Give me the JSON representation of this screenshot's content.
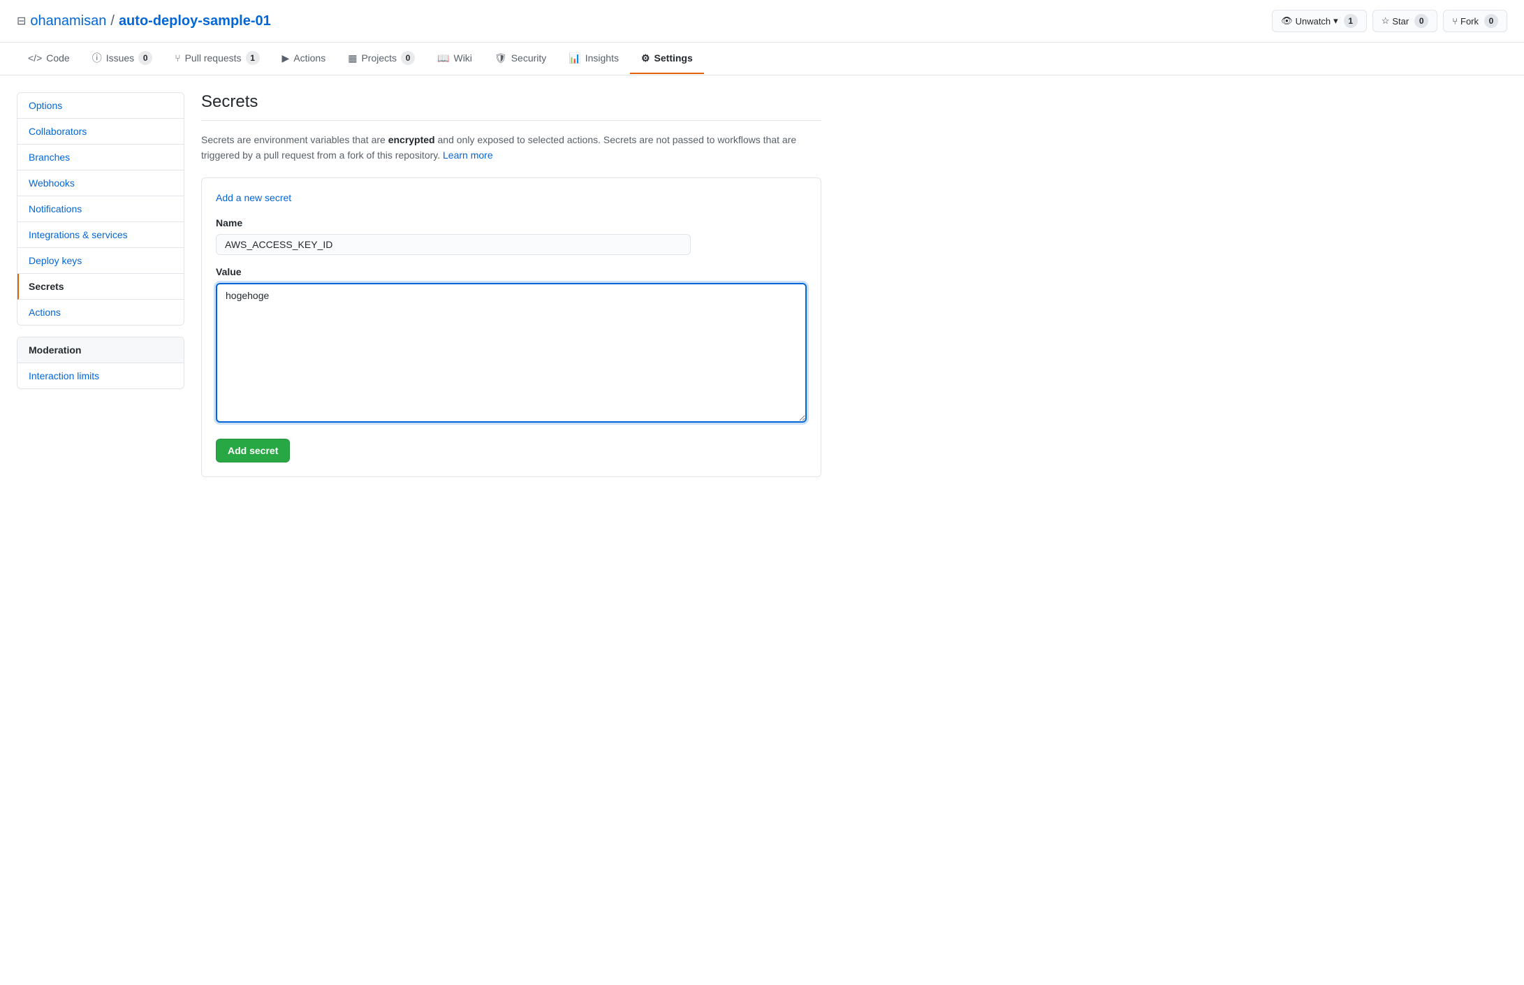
{
  "header": {
    "repo_icon": "📁",
    "owner": "ohanamisan",
    "separator": "/",
    "repo_name": "auto-deploy-sample-01",
    "unwatch_label": "Unwatch",
    "unwatch_count": "1",
    "star_label": "Star",
    "star_count": "0",
    "fork_label": "Fork",
    "fork_count": "0"
  },
  "nav": {
    "tabs": [
      {
        "id": "code",
        "label": "Code",
        "icon": "<>",
        "badge": null,
        "active": false
      },
      {
        "id": "issues",
        "label": "Issues",
        "icon": "ⓘ",
        "badge": "0",
        "active": false
      },
      {
        "id": "pull-requests",
        "label": "Pull requests",
        "icon": "⑂",
        "badge": "1",
        "active": false
      },
      {
        "id": "actions",
        "label": "Actions",
        "icon": "▶",
        "badge": null,
        "active": false
      },
      {
        "id": "projects",
        "label": "Projects",
        "icon": "▦",
        "badge": "0",
        "active": false
      },
      {
        "id": "wiki",
        "label": "Wiki",
        "icon": "📖",
        "badge": null,
        "active": false
      },
      {
        "id": "security",
        "label": "Security",
        "icon": "🛡",
        "badge": null,
        "active": false
      },
      {
        "id": "insights",
        "label": "Insights",
        "icon": "📊",
        "badge": null,
        "active": false
      },
      {
        "id": "settings",
        "label": "Settings",
        "icon": "⚙",
        "badge": null,
        "active": true
      }
    ]
  },
  "sidebar": {
    "main_section": {
      "items": [
        {
          "id": "options",
          "label": "Options",
          "active": false
        },
        {
          "id": "collaborators",
          "label": "Collaborators",
          "active": false
        },
        {
          "id": "branches",
          "label": "Branches",
          "active": false
        },
        {
          "id": "webhooks",
          "label": "Webhooks",
          "active": false
        },
        {
          "id": "notifications",
          "label": "Notifications",
          "active": false
        },
        {
          "id": "integrations",
          "label": "Integrations & services",
          "active": false
        },
        {
          "id": "deploy-keys",
          "label": "Deploy keys",
          "active": false
        },
        {
          "id": "secrets",
          "label": "Secrets",
          "active": true
        },
        {
          "id": "actions",
          "label": "Actions",
          "active": false
        }
      ]
    },
    "moderation_section": {
      "header": "Moderation",
      "items": [
        {
          "id": "interaction-limits",
          "label": "Interaction limits",
          "active": false
        }
      ]
    }
  },
  "content": {
    "title": "Secrets",
    "description_plain": "Secrets are environment variables that are ",
    "description_bold": "encrypted",
    "description_plain2": " and only exposed to selected actions. Secrets are not passed to workflows that are triggered by a pull request from a fork of this repository. ",
    "description_link": "Learn more",
    "add_secret_link": "Add a new secret",
    "form": {
      "name_label": "Name",
      "name_placeholder": "",
      "name_value": "AWS_ACCESS_KEY_ID",
      "value_label": "Value",
      "value_value": "hogehoge"
    },
    "add_button_label": "Add secret"
  }
}
